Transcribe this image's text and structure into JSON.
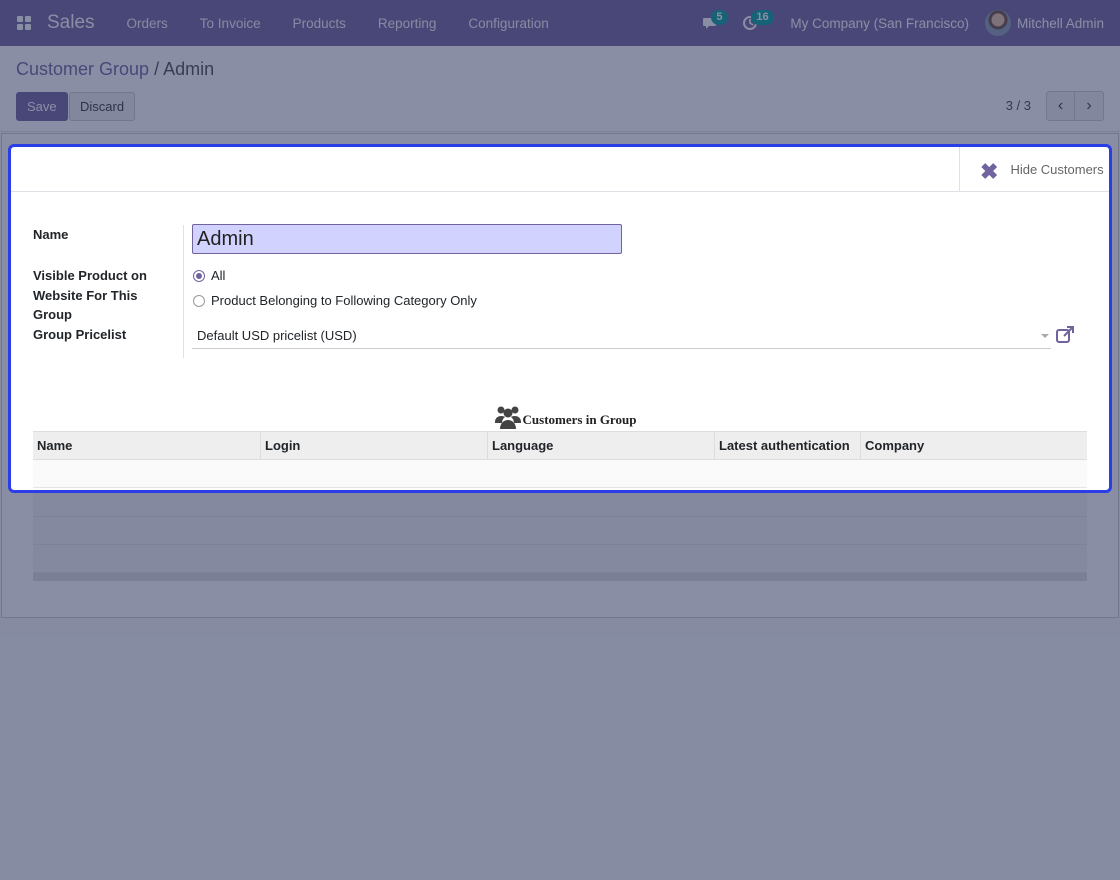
{
  "navbar": {
    "app_name": "Sales",
    "menu": [
      "Orders",
      "To Invoice",
      "Products",
      "Reporting",
      "Configuration"
    ],
    "messages_count": "5",
    "activities_count": "16",
    "company": "My Company (San Francisco)",
    "user": "Mitchell Admin"
  },
  "breadcrumb": {
    "parent": "Customer Group",
    "separator": "/",
    "current": "Admin"
  },
  "buttons": {
    "save": "Save",
    "discard": "Discard"
  },
  "pager": {
    "value": "3 / 3"
  },
  "stat_button": {
    "label": "Hide Customers"
  },
  "form": {
    "name_label": "Name",
    "name_value": "Admin",
    "visibility_label": "Visible Product on Website For This Group",
    "visibility_options": [
      "All",
      "Product Belonging to Following Category Only"
    ],
    "visibility_selected": "All",
    "pricelist_label": "Group Pricelist",
    "pricelist_value": "Default USD pricelist (USD)"
  },
  "customers": {
    "title": "Customers in Group",
    "columns": [
      "Name",
      "Login",
      "Language",
      "Latest authentication",
      "Company"
    ],
    "rows": []
  },
  "colors": {
    "brand": "#71639e",
    "highlight_frame": "#2b3ee6",
    "badge": "#00a09d"
  }
}
